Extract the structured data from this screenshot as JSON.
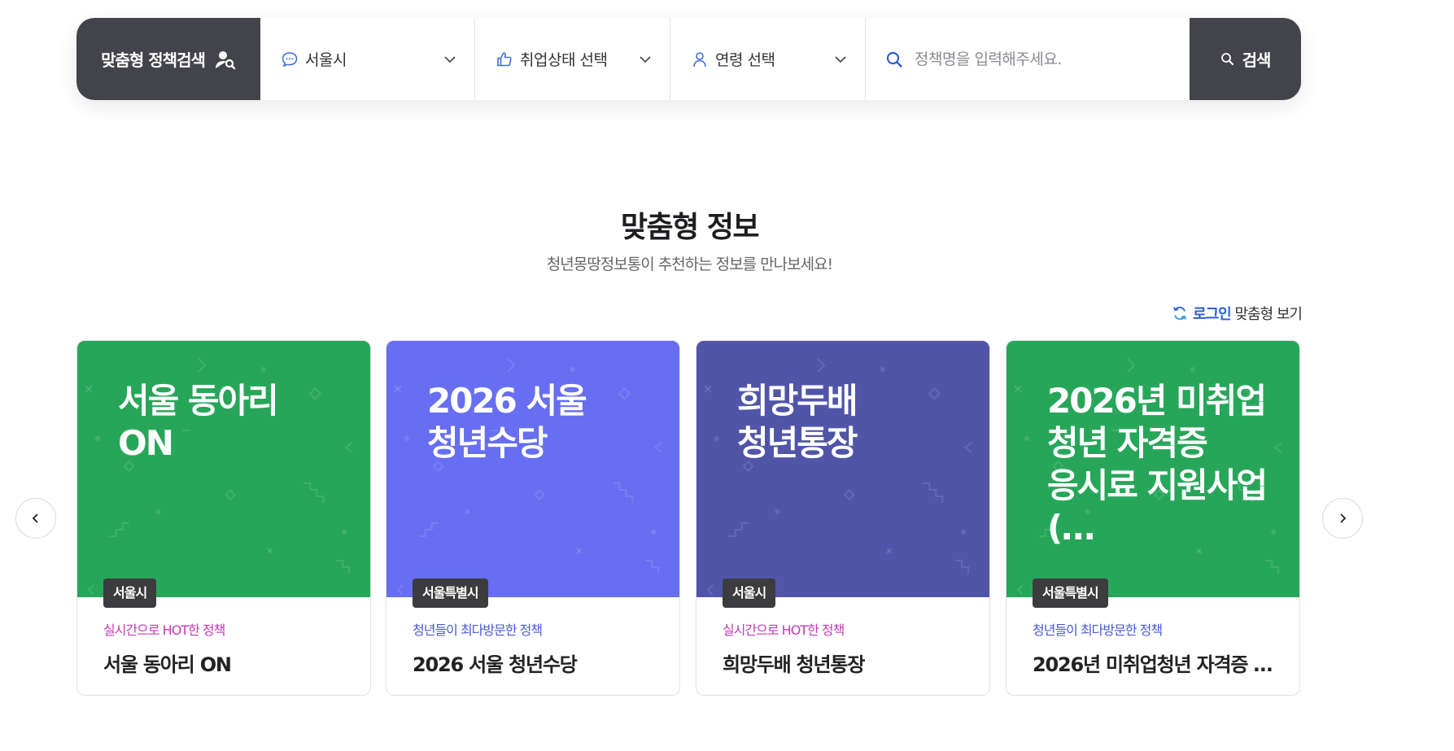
{
  "search": {
    "title": "맞춤형 정책검색",
    "region": "서울시",
    "employment": "취업상태 선택",
    "age": "연령 선택",
    "placeholder": "정책명을 입력해주세요.",
    "button": "검색"
  },
  "section": {
    "title": "맞춤형 정보",
    "subtitle": "청년몽땅정보통이 추천하는 정보를 만나보세요!",
    "login_bold": "로그인",
    "login_rest": " 맞춤형 보기"
  },
  "cards": [
    {
      "image_title": "서울 동아리 ON",
      "badge": "서울시",
      "tag": "실시간으로 HOT한 정책",
      "name": "서울 동아리 ON",
      "color": "#27a65a"
    },
    {
      "image_title": "2026 서울 청년수당",
      "badge": "서울특별시",
      "tag": "청년들이 최다방문한 정책",
      "name": "2026 서울 청년수당",
      "color": "#676ef1"
    },
    {
      "image_title": "희망두배 청년통장",
      "badge": "서울시",
      "tag": "실시간으로 HOT한 정책",
      "name": "희망두배 청년통장",
      "color": "#5155a8"
    },
    {
      "image_title": "2026년 미취업 청년 자격증 응시료 지원사업(…",
      "badge": "서울특별시",
      "tag": "청년들이 최다방문한 정책",
      "name": "2026년 미취업청년 자격증 …",
      "color": "#27a65a"
    }
  ],
  "colors": {
    "dark": "#43434b",
    "link_blue": "#2f5fd0",
    "tag_hot": "#c23ab5",
    "tag_visit": "#4a58d6"
  }
}
